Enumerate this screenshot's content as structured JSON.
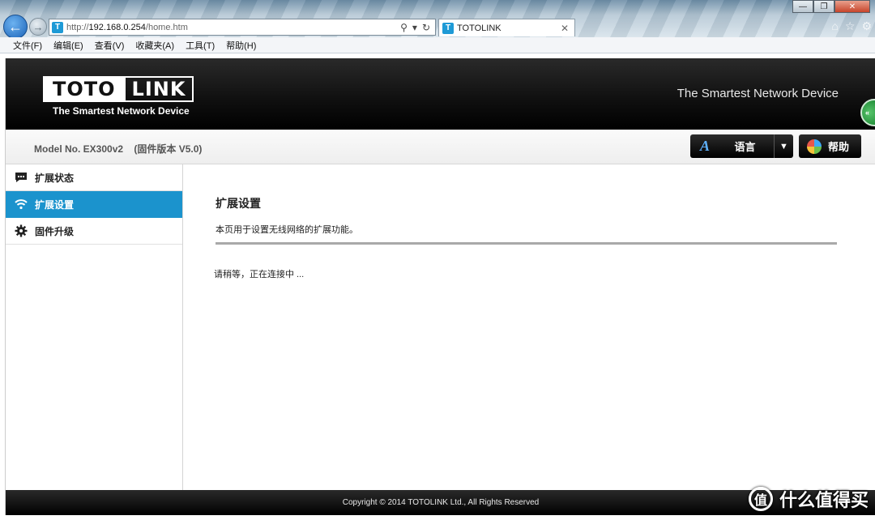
{
  "browser": {
    "url_prefix": "http://",
    "url_host": "192.168.0.254",
    "url_path": "/home.htm",
    "tab_title": "TOTOLINK",
    "menu": [
      "文件(F)",
      "编辑(E)",
      "查看(V)",
      "收藏夹(A)",
      "工具(T)",
      "帮助(H)"
    ]
  },
  "header": {
    "logo_left": "TOTO",
    "logo_right": "LINK",
    "logo_tagline": "The Smartest Network Device",
    "slogan": "The Smartest Network Device"
  },
  "infobar": {
    "model": "Model No. EX300v2",
    "firmware": "(固件版本 V5.0)",
    "language_label": "语言",
    "help_label": "帮助"
  },
  "sidebar": {
    "items": [
      {
        "label": "扩展状态",
        "icon": "chat-icon",
        "active": false
      },
      {
        "label": "扩展设置",
        "icon": "wifi-icon",
        "active": true
      },
      {
        "label": "固件升级",
        "icon": "gear-icon",
        "active": false
      }
    ]
  },
  "content": {
    "title": "扩展设置",
    "description": "本页用于设置无线网络的扩展功能。",
    "status": "请稍等，正在连接中 ..."
  },
  "footer": {
    "copyright": "Copyright © 2014 TOTOLINK Ltd.,   All Rights Reserved"
  },
  "watermark": {
    "text": "什么值得买",
    "icon_glyph": "值"
  },
  "colors": {
    "accent": "#1b93cd",
    "header_bg": "#111111"
  }
}
